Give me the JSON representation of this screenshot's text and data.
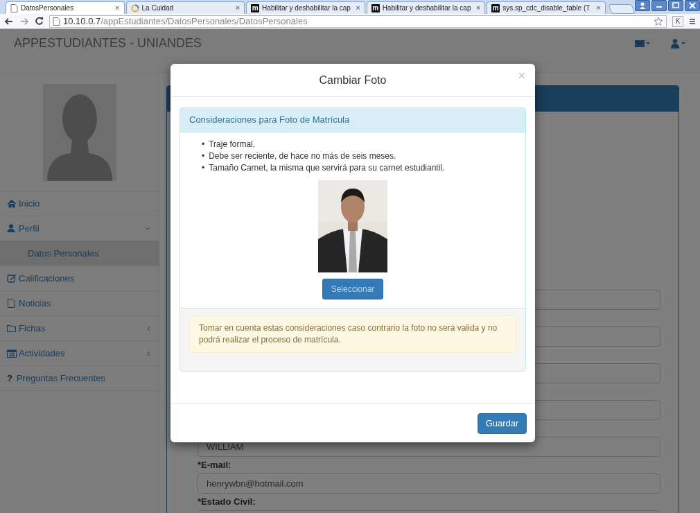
{
  "browser": {
    "tabs": [
      {
        "title": "DatosPersonales",
        "selected": true,
        "favicon": {
          "kind": "page"
        },
        "close": "×"
      },
      {
        "title": "La Cuidad",
        "selected": false,
        "favicon": {
          "kind": "spinner"
        },
        "close": "×"
      },
      {
        "title": "Habilitar y deshabilitar la cap",
        "selected": false,
        "favicon": {
          "kind": "letter",
          "text": "m"
        },
        "close": "×"
      },
      {
        "title": "Habilitar y deshabilitar la cap",
        "selected": false,
        "favicon": {
          "kind": "letter",
          "text": "m"
        },
        "close": "×"
      },
      {
        "title": "sys.sp_cdc_disable_table (T",
        "selected": false,
        "favicon": {
          "kind": "letter",
          "text": "m"
        },
        "close": "×"
      }
    ],
    "address": {
      "host": "10.10.0.7",
      "path": "/appEstudiantes/DatosPersonales/DatosPersonales"
    },
    "extension_letter": "K"
  },
  "navbar": {
    "brand": "APPESTUDIANTES - UNIANDES"
  },
  "sidebar": {
    "items": [
      {
        "label": "Inicio",
        "kind": "home"
      },
      {
        "label": "Perfil",
        "kind": "user",
        "expanded": true,
        "children": [
          {
            "label": "Datos Personales",
            "selected": true
          }
        ]
      },
      {
        "label": "Calificaciones",
        "kind": "edit"
      },
      {
        "label": "Noticias",
        "kind": "file"
      },
      {
        "label": "Fichas",
        "kind": "folder",
        "expanded": false
      },
      {
        "label": "Actividades",
        "kind": "calendar",
        "expanded": false
      },
      {
        "label": "Preguntas Frecuentes",
        "kind": "glyph",
        "glyph": "?"
      }
    ]
  },
  "form": {
    "fields": [
      {
        "kind": "input"
      },
      {
        "kind": "input"
      },
      {
        "kind": "input"
      },
      {
        "kind": "input"
      },
      {
        "kind": "input",
        "value": "WILLIAM"
      },
      {
        "kind": "input",
        "label_mark": "*",
        "label": "E-mail:",
        "value": "henrywbn@hotmail.com"
      },
      {
        "kind": "input",
        "label_mark": "*",
        "label": "Estado Civil:"
      }
    ]
  },
  "modal": {
    "title": "Cambiar Foto",
    "close": "×",
    "panel": {
      "heading": "Consideraciones para Foto de Matrícula",
      "bullets": [
        {
          "marker": "•",
          "text": "Traje formal."
        },
        {
          "marker": "•",
          "text": "Debe ser reciente, de hace no más de seis meses."
        },
        {
          "marker": "•",
          "text": "Tamaño Carnet, la misma que servirá para su carnet estudiantil."
        }
      ],
      "select_button": "Seleccionar",
      "warning": "Tomar en cuenta estas consideraciones caso contrario la foto no será valida y no podrá realizar el proceso de matrícula."
    },
    "save_button": "Guardar"
  }
}
